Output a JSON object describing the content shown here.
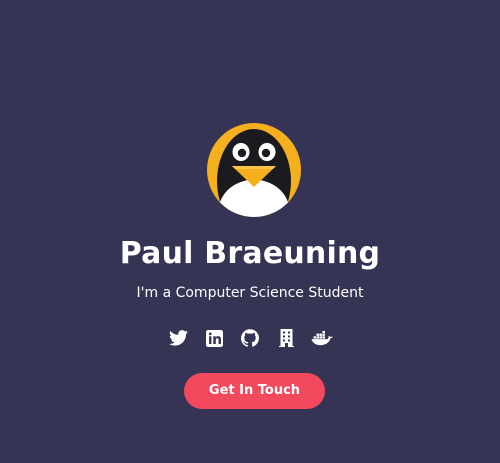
{
  "profile": {
    "name": "Paul Braeuning",
    "tagline": "I'm a Computer Science Student",
    "avatar_icon": "penguin-avatar-icon"
  },
  "socials": [
    {
      "icon": "twitter-icon"
    },
    {
      "icon": "linkedin-icon"
    },
    {
      "icon": "github-icon"
    },
    {
      "icon": "building-icon"
    },
    {
      "icon": "docker-icon"
    }
  ],
  "cta": {
    "label": "Get In Touch"
  },
  "colors": {
    "background": "#363455",
    "accent": "#f2495f",
    "avatar_ring": "#f6b01e",
    "text": "#ffffff"
  }
}
